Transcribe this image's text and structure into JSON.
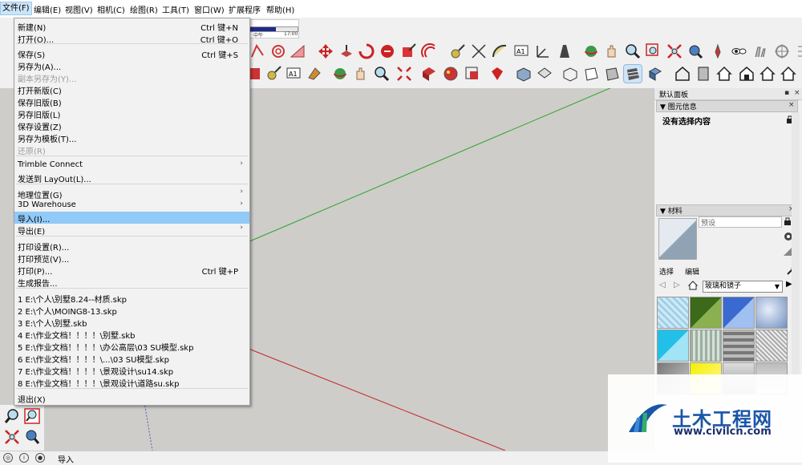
{
  "menubar": {
    "items": [
      "文件(F)",
      "编辑(E)",
      "视图(V)",
      "相机(C)",
      "绘图(R)",
      "工具(T)",
      "窗口(W)",
      "扩展程序",
      "帮助(H)"
    ]
  },
  "shadow": {
    "label_mid": "中午",
    "label_time": "17:00",
    "fill_fraction": 0.55
  },
  "file_menu": {
    "items": [
      {
        "label": "新建(N)",
        "shortcut": "Ctrl 键+N"
      },
      {
        "label": "打开(O)...",
        "shortcut": "Ctrl 键+O"
      },
      {
        "label": "保存(S)",
        "shortcut": "Ctrl 键+S"
      },
      {
        "label": "另存为(A)..."
      },
      {
        "label": "副本另存为(Y)..."
      },
      {
        "label": "打开新版(C)"
      },
      {
        "label": "保存旧版(B)"
      },
      {
        "label": "另存旧版(L)"
      },
      {
        "label": "保存设置(Z)"
      },
      {
        "label": "另存为模板(T)..."
      },
      {
        "label": "还原(R)"
      },
      {
        "label": "Trimble Connect"
      },
      {
        "label": "发送到 LayOut(L)..."
      },
      {
        "label": "地理位置(G)"
      },
      {
        "label": "3D Warehouse"
      },
      {
        "label": "导入(I)..."
      },
      {
        "label": "导出(E)"
      },
      {
        "label": "打印设置(R)..."
      },
      {
        "label": "打印预览(V)..."
      },
      {
        "label": "打印(P)...",
        "shortcut": "Ctrl 键+P"
      },
      {
        "label": "生成报告..."
      },
      {
        "label": "1 E:\\个人\\别墅8.24--材质.skp"
      },
      {
        "label": "2 E:\\个人\\MOING8-13.skp"
      },
      {
        "label": "3 E:\\个人\\别墅.skb"
      },
      {
        "label": "4 E:\\作业文档！！！！\\别墅.skb"
      },
      {
        "label": "5 E:\\作业文档！！！！\\办公高层\\03  SU模型.skp"
      },
      {
        "label": "6 E:\\作业文档！！！！\\...\\03  SU模型.skp"
      },
      {
        "label": "7 E:\\作业文档！！！！\\景观设计\\su14.skp"
      },
      {
        "label": "8 E:\\作业文档！！！！\\景观设计\\道路su.skp"
      },
      {
        "label": "退出(X)"
      }
    ]
  },
  "tray": {
    "title": "默认面板",
    "entity_info": {
      "header": "图元信息",
      "status": "没有选择内容"
    },
    "materials": {
      "header": "材料",
      "name_placeholder": "预设",
      "tab_select": "选择",
      "tab_edit": "编辑",
      "collection": "玻璃和镜子"
    }
  },
  "statusbar": {
    "text": "导入"
  },
  "watermark": {
    "main": "土木工程网",
    "url": "www.civilcn.com"
  },
  "colors": {
    "axis_green": "#2aa52a",
    "axis_red": "#c0282a",
    "menu_highlight": "#91c9f7",
    "viewport_bg": "#cfcdca"
  }
}
